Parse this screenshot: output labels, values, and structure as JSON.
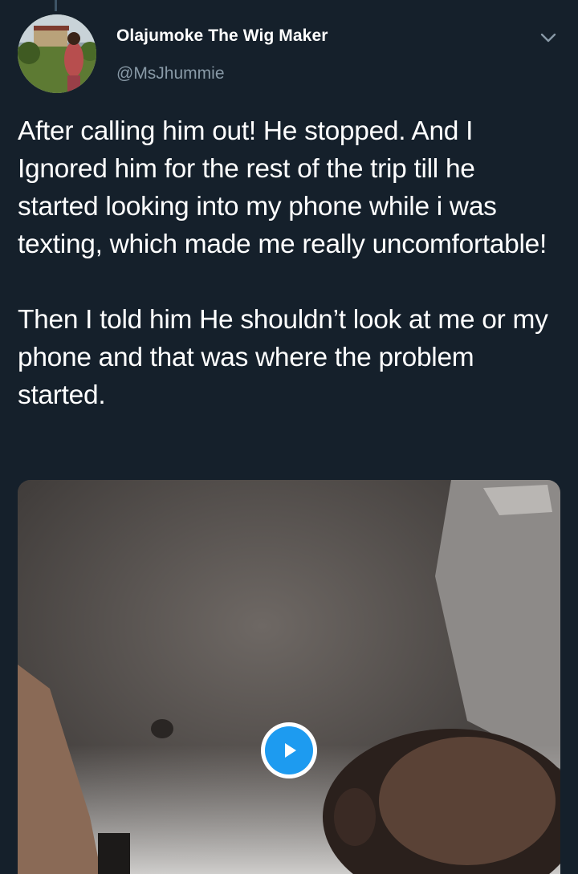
{
  "tweet": {
    "author_name": "Olajumoke The Wig Maker",
    "author_handle": "@MsJhummie",
    "paragraphs": [
      "After calling him out! He stopped. And I Ignored him for the rest of the trip till he started looking into my phone while i was texting, which made me really uncomfortable!",
      "Then I told him He shouldn’t look at me or my phone and that was where the problem started."
    ],
    "menu_icon": "chevron-down-icon",
    "media_icon": "play-icon"
  },
  "colors": {
    "background": "#15202b",
    "secondary_text": "#8899a6",
    "accent": "#1d9bf0"
  }
}
